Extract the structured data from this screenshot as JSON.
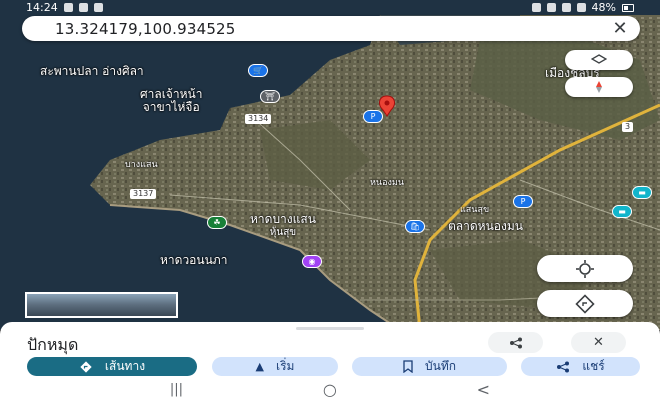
{
  "status_bar": {
    "time": "14:24",
    "battery": "48%"
  },
  "search": {
    "query": "13.324179,100.934525",
    "close_icon": "close-icon"
  },
  "map": {
    "labels": {
      "pier": "สะพานปลา อ่างศิลา",
      "shrine_line1": "ศาลเจ้าหน้า",
      "shrine_line2": "จาขาไห่จือ",
      "road_3134": "3134",
      "road_3137": "3137",
      "road_3": "3",
      "beach_line1": "หาดบางแสน",
      "beach_line2": "หุ้นสุข",
      "hat_wonnapa": "หาดวอนนภา",
      "sukhumvit_area": "ตลาดหนองมน",
      "district_1": "บางแสน",
      "district_2": "หนองมน",
      "district_3": "แสนสุข",
      "top_right": "เมืองชลบุรี"
    },
    "colors": {
      "sea": "#1f3243",
      "land": "#6d6a52",
      "pin": "#ea4335",
      "road_main": "#e0b33c"
    }
  },
  "sheet": {
    "title": "ปักหมุด",
    "share_icon": "share-icon",
    "close_icon": "close-icon",
    "chips": [
      {
        "label": "เส้นทาง",
        "icon": "directions-icon"
      },
      {
        "label": "เริ่ม",
        "icon": "navigation-arrow-icon"
      },
      {
        "label": "บันทึก",
        "icon": "bookmark-icon"
      },
      {
        "label": "แชร์",
        "icon": "share-icon"
      }
    ]
  },
  "navbar": {
    "recents": "|||",
    "home": "○",
    "back": "<"
  }
}
